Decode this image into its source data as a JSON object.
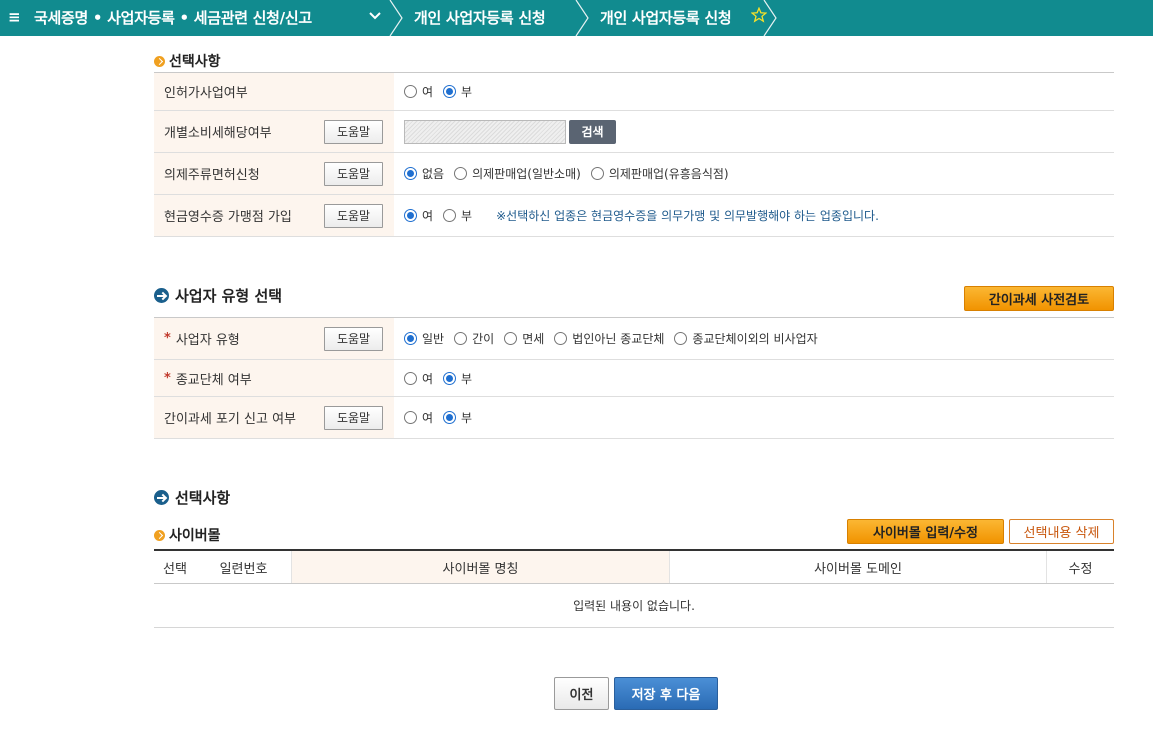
{
  "topbar": {
    "menu_icon": "hamburger-menu-icon",
    "breadcrumb1": "국세증명 • 사업자등록 • 세금관련 신청/신고",
    "breadcrumb2": "개인 사업자등록 신청",
    "breadcrumb3": "개인 사업자등록 신청",
    "star_icon": "favorite-star-icon"
  },
  "optional_section": {
    "title": "선택사항",
    "rows": [
      {
        "label": "인허가사업여부",
        "options": [
          "여",
          "부"
        ],
        "selected": "부"
      },
      {
        "label": "개별소비세해당여부",
        "help": "도움말",
        "search_label": "검색"
      },
      {
        "label": "의제주류면허신청",
        "help": "도움말",
        "options": [
          "없음",
          "의제판매업(일반소매)",
          "의제판매업(유흥음식점)"
        ],
        "selected": "없음"
      },
      {
        "label": "현금영수증 가맹점 가입",
        "help": "도움말",
        "options": [
          "여",
          "부"
        ],
        "selected": "여",
        "notice": "※선택하신 업종은 현금영수증을 의무가맹 및 의무발행해야 하는 업종입니다."
      }
    ]
  },
  "business_type_section": {
    "title": "사업자 유형 선택",
    "precheck_button": "간이과세 사전검토",
    "rows": [
      {
        "required": "*",
        "label": "사업자 유형",
        "help": "도움말",
        "options": [
          "일반",
          "간이",
          "면세",
          "법인아닌 종교단체",
          "종교단체이외의 비사업자"
        ],
        "selected": "일반"
      },
      {
        "required": "*",
        "label": "종교단체 여부",
        "options": [
          "여",
          "부"
        ],
        "selected": "부"
      },
      {
        "label": "간이과세 포기 신고 여부",
        "help": "도움말",
        "options": [
          "여",
          "부"
        ],
        "selected": "부"
      }
    ]
  },
  "selection_section": {
    "title": "선택사항",
    "cybermall": {
      "title": "사이버몰",
      "edit_button": "사이버몰 입력/수정",
      "delete_button": "선택내용 삭제",
      "columns": [
        "선택",
        "일련번호",
        "사이버몰 명칭",
        "사이버몰 도메인",
        "수정"
      ],
      "empty_message": "입력된 내용이 없습니다."
    }
  },
  "footer": {
    "prev_button": "이전",
    "next_button": "저장 후 다음"
  },
  "colors": {
    "topbar": "#118b8f",
    "label_bg": "#fdf5ee",
    "accent_orange": "#f19300",
    "primary_blue": "#2a6bb4",
    "radio_blue": "#1f6fd0"
  }
}
